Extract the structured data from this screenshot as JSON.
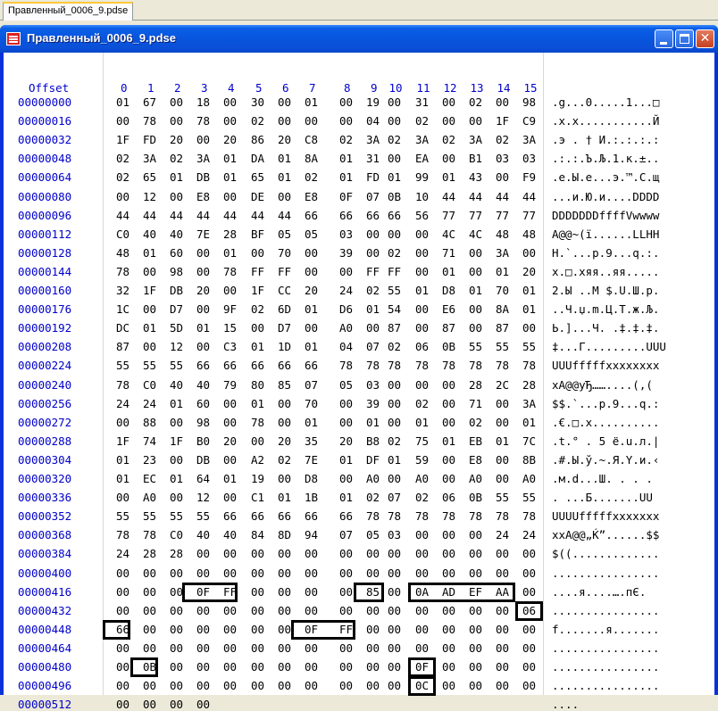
{
  "tab": {
    "label": "Правленный_0006_9.pdse"
  },
  "window": {
    "title": "Правленный_0006_9.pdse"
  },
  "header": {
    "offset_label": "Offset",
    "columns": [
      "0",
      "1",
      "2",
      "3",
      "4",
      "5",
      "6",
      "7",
      "8",
      "9",
      "10",
      "11",
      "12",
      "13",
      "14",
      "15"
    ]
  },
  "rows": [
    {
      "offset": "00000000",
      "bytes": [
        "01",
        "67",
        "00",
        "18",
        "00",
        "30",
        "00",
        "01",
        "00",
        "19",
        "00",
        "31",
        "00",
        "02",
        "00",
        "98"
      ],
      "ascii": ".g...0.....1...□"
    },
    {
      "offset": "00000016",
      "bytes": [
        "00",
        "78",
        "00",
        "78",
        "00",
        "02",
        "00",
        "00",
        "00",
        "04",
        "00",
        "02",
        "00",
        "00",
        "1F",
        "C9"
      ],
      "ascii": ".x.x...........Й"
    },
    {
      "offset": "00000032",
      "bytes": [
        "1F",
        "FD",
        "20",
        "00",
        "20",
        "86",
        "20",
        "C8",
        "02",
        "3A",
        "02",
        "3A",
        "02",
        "3A",
        "02",
        "3A"
      ],
      "ascii": ".э . † И.:.:.:.:"
    },
    {
      "offset": "00000048",
      "bytes": [
        "02",
        "3A",
        "02",
        "3A",
        "01",
        "DA",
        "01",
        "8A",
        "01",
        "31",
        "00",
        "EA",
        "00",
        "B1",
        "03",
        "03"
      ],
      "ascii": ".:.:.Ъ.Љ.1.к.±.."
    },
    {
      "offset": "00000064",
      "bytes": [
        "02",
        "65",
        "01",
        "DB",
        "01",
        "65",
        "01",
        "02",
        "01",
        "FD",
        "01",
        "99",
        "01",
        "43",
        "00",
        "F9"
      ],
      "ascii": ".e.Ы.e...э.™.C.щ"
    },
    {
      "offset": "00000080",
      "bytes": [
        "00",
        "12",
        "00",
        "E8",
        "00",
        "DE",
        "00",
        "E8",
        "0F",
        "07",
        "0B",
        "10",
        "44",
        "44",
        "44",
        "44"
      ],
      "ascii": "...и.Ю.и....DDDD"
    },
    {
      "offset": "00000096",
      "bytes": [
        "44",
        "44",
        "44",
        "44",
        "44",
        "44",
        "44",
        "66",
        "66",
        "66",
        "66",
        "56",
        "77",
        "77",
        "77",
        "77"
      ],
      "ascii": "DDDDDDDffffVwwww"
    },
    {
      "offset": "00000112",
      "bytes": [
        "C0",
        "40",
        "40",
        "7E",
        "28",
        "BF",
        "05",
        "05",
        "03",
        "00",
        "00",
        "00",
        "4C",
        "4C",
        "48",
        "48"
      ],
      "ascii": "A@@~(ї......LLHH"
    },
    {
      "offset": "00000128",
      "bytes": [
        "48",
        "01",
        "60",
        "00",
        "01",
        "00",
        "70",
        "00",
        "39",
        "00",
        "02",
        "00",
        "71",
        "00",
        "3A",
        "00"
      ],
      "ascii": "H.`...p.9...q.:."
    },
    {
      "offset": "00000144",
      "bytes": [
        "78",
        "00",
        "98",
        "00",
        "78",
        "FF",
        "FF",
        "00",
        "00",
        "FF",
        "FF",
        "00",
        "01",
        "00",
        "01",
        "20"
      ],
      "ascii": "x.□.xяя..яя..... "
    },
    {
      "offset": "00000160",
      "bytes": [
        "32",
        "1F",
        "DB",
        "20",
        "00",
        "1F",
        "CC",
        "20",
        "24",
        "02",
        "55",
        "01",
        "D8",
        "01",
        "70",
        "01"
      ],
      "ascii": "2.Ы ..М $.U.Ш.p."
    },
    {
      "offset": "00000176",
      "bytes": [
        "1C",
        "00",
        "D7",
        "00",
        "9F",
        "02",
        "6D",
        "01",
        "D6",
        "01",
        "54",
        "00",
        "E6",
        "00",
        "8A",
        "01"
      ],
      "ascii": "..Ч.џ.m.Ц.T.ж.Љ."
    },
    {
      "offset": "00000192",
      "bytes": [
        "DC",
        "01",
        "5D",
        "01",
        "15",
        "00",
        "D7",
        "00",
        "A0",
        "00",
        "87",
        "00",
        "87",
        "00",
        "87",
        "00"
      ],
      "ascii": "Ь.]...Ч. .‡.‡.‡."
    },
    {
      "offset": "00000208",
      "bytes": [
        "87",
        "00",
        "12",
        "00",
        "C3",
        "01",
        "1D",
        "01",
        "04",
        "07",
        "02",
        "06",
        "0B",
        "55",
        "55",
        "55"
      ],
      "ascii": "‡...Г.........UUU"
    },
    {
      "offset": "00000224",
      "bytes": [
        "55",
        "55",
        "55",
        "66",
        "66",
        "66",
        "66",
        "66",
        "78",
        "78",
        "78",
        "78",
        "78",
        "78",
        "78",
        "78"
      ],
      "ascii": "UUUfffffxxxxxxxx"
    },
    {
      "offset": "00000240",
      "bytes": [
        "78",
        "C0",
        "40",
        "40",
        "79",
        "80",
        "85",
        "07",
        "05",
        "03",
        "00",
        "00",
        "00",
        "28",
        "2C",
        "28"
      ],
      "ascii": "xA@@yЂ……....(,("
    },
    {
      "offset": "00000256",
      "bytes": [
        "24",
        "24",
        "01",
        "60",
        "00",
        "01",
        "00",
        "70",
        "00",
        "39",
        "00",
        "02",
        "00",
        "71",
        "00",
        "3A"
      ],
      "ascii": "$$.`...p.9...q.:"
    },
    {
      "offset": "00000272",
      "bytes": [
        "00",
        "88",
        "00",
        "98",
        "00",
        "78",
        "00",
        "01",
        "00",
        "01",
        "00",
        "01",
        "00",
        "02",
        "00",
        "01"
      ],
      "ascii": ".€.□.x.........."
    },
    {
      "offset": "00000288",
      "bytes": [
        "1F",
        "74",
        "1F",
        "B0",
        "20",
        "00",
        "20",
        "35",
        "20",
        "B8",
        "02",
        "75",
        "01",
        "EB",
        "01",
        "7C"
      ],
      "ascii": ".t.° . 5 ё.u.л.|"
    },
    {
      "offset": "00000304",
      "bytes": [
        "01",
        "23",
        "00",
        "DB",
        "00",
        "A2",
        "02",
        "7E",
        "01",
        "DF",
        "01",
        "59",
        "00",
        "E8",
        "00",
        "8B"
      ],
      "ascii": ".#.Ы.ў.~.Я.Y.и.‹"
    },
    {
      "offset": "00000320",
      "bytes": [
        "01",
        "EC",
        "01",
        "64",
        "01",
        "19",
        "00",
        "D8",
        "00",
        "A0",
        "00",
        "A0",
        "00",
        "A0",
        "00",
        "A0"
      ],
      "ascii": ".м.d...Ш. . . . "
    },
    {
      "offset": "00000336",
      "bytes": [
        "00",
        "A0",
        "00",
        "12",
        "00",
        "C1",
        "01",
        "1B",
        "01",
        "02",
        "07",
        "02",
        "06",
        "0B",
        "55",
        "55"
      ],
      "ascii": ". ...Б.......UU"
    },
    {
      "offset": "00000352",
      "bytes": [
        "55",
        "55",
        "55",
        "55",
        "66",
        "66",
        "66",
        "66",
        "66",
        "78",
        "78",
        "78",
        "78",
        "78",
        "78",
        "78"
      ],
      "ascii": "UUUUfffffxxxxxxx"
    },
    {
      "offset": "00000368",
      "bytes": [
        "78",
        "78",
        "C0",
        "40",
        "40",
        "84",
        "8D",
        "94",
        "07",
        "05",
        "03",
        "00",
        "00",
        "00",
        "24",
        "24"
      ],
      "ascii": "xxA@@„Ќ”......$$"
    },
    {
      "offset": "00000384",
      "bytes": [
        "24",
        "28",
        "28",
        "00",
        "00",
        "00",
        "00",
        "00",
        "00",
        "00",
        "00",
        "00",
        "00",
        "00",
        "00",
        "00"
      ],
      "ascii": "$((............."
    },
    {
      "offset": "00000400",
      "bytes": [
        "00",
        "00",
        "00",
        "00",
        "00",
        "00",
        "00",
        "00",
        "00",
        "00",
        "00",
        "00",
        "00",
        "00",
        "00",
        "00"
      ],
      "ascii": "................"
    },
    {
      "offset": "00000416",
      "bytes": [
        "00",
        "00",
        "00",
        "0F",
        "FF",
        "00",
        "00",
        "00",
        "00",
        "85",
        "00",
        "0A",
        "AD",
        "EF",
        "AA",
        "00"
      ],
      "ascii": "....я....….­пЄ."
    },
    {
      "offset": "00000432",
      "bytes": [
        "00",
        "00",
        "00",
        "00",
        "00",
        "00",
        "00",
        "00",
        "00",
        "00",
        "00",
        "00",
        "00",
        "00",
        "00",
        "06"
      ],
      "ascii": "................"
    },
    {
      "offset": "00000448",
      "bytes": [
        "66",
        "00",
        "00",
        "00",
        "00",
        "00",
        "00",
        "0F",
        "FF",
        "00",
        "00",
        "00",
        "00",
        "00",
        "00",
        "00"
      ],
      "ascii": "f.......я......."
    },
    {
      "offset": "00000464",
      "bytes": [
        "00",
        "00",
        "00",
        "00",
        "00",
        "00",
        "00",
        "00",
        "00",
        "00",
        "00",
        "00",
        "00",
        "00",
        "00",
        "00"
      ],
      "ascii": "................"
    },
    {
      "offset": "00000480",
      "bytes": [
        "00",
        "0B",
        "00",
        "00",
        "00",
        "00",
        "00",
        "00",
        "00",
        "00",
        "00",
        "0F",
        "00",
        "00",
        "00",
        "00"
      ],
      "ascii": "................"
    },
    {
      "offset": "00000496",
      "bytes": [
        "00",
        "00",
        "00",
        "00",
        "00",
        "00",
        "00",
        "00",
        "00",
        "00",
        "00",
        "0C",
        "00",
        "00",
        "00",
        "00"
      ],
      "ascii": "................"
    },
    {
      "offset": "00000512",
      "bytes": [
        "00",
        "00",
        "00",
        "00"
      ],
      "ascii": "...."
    }
  ]
}
